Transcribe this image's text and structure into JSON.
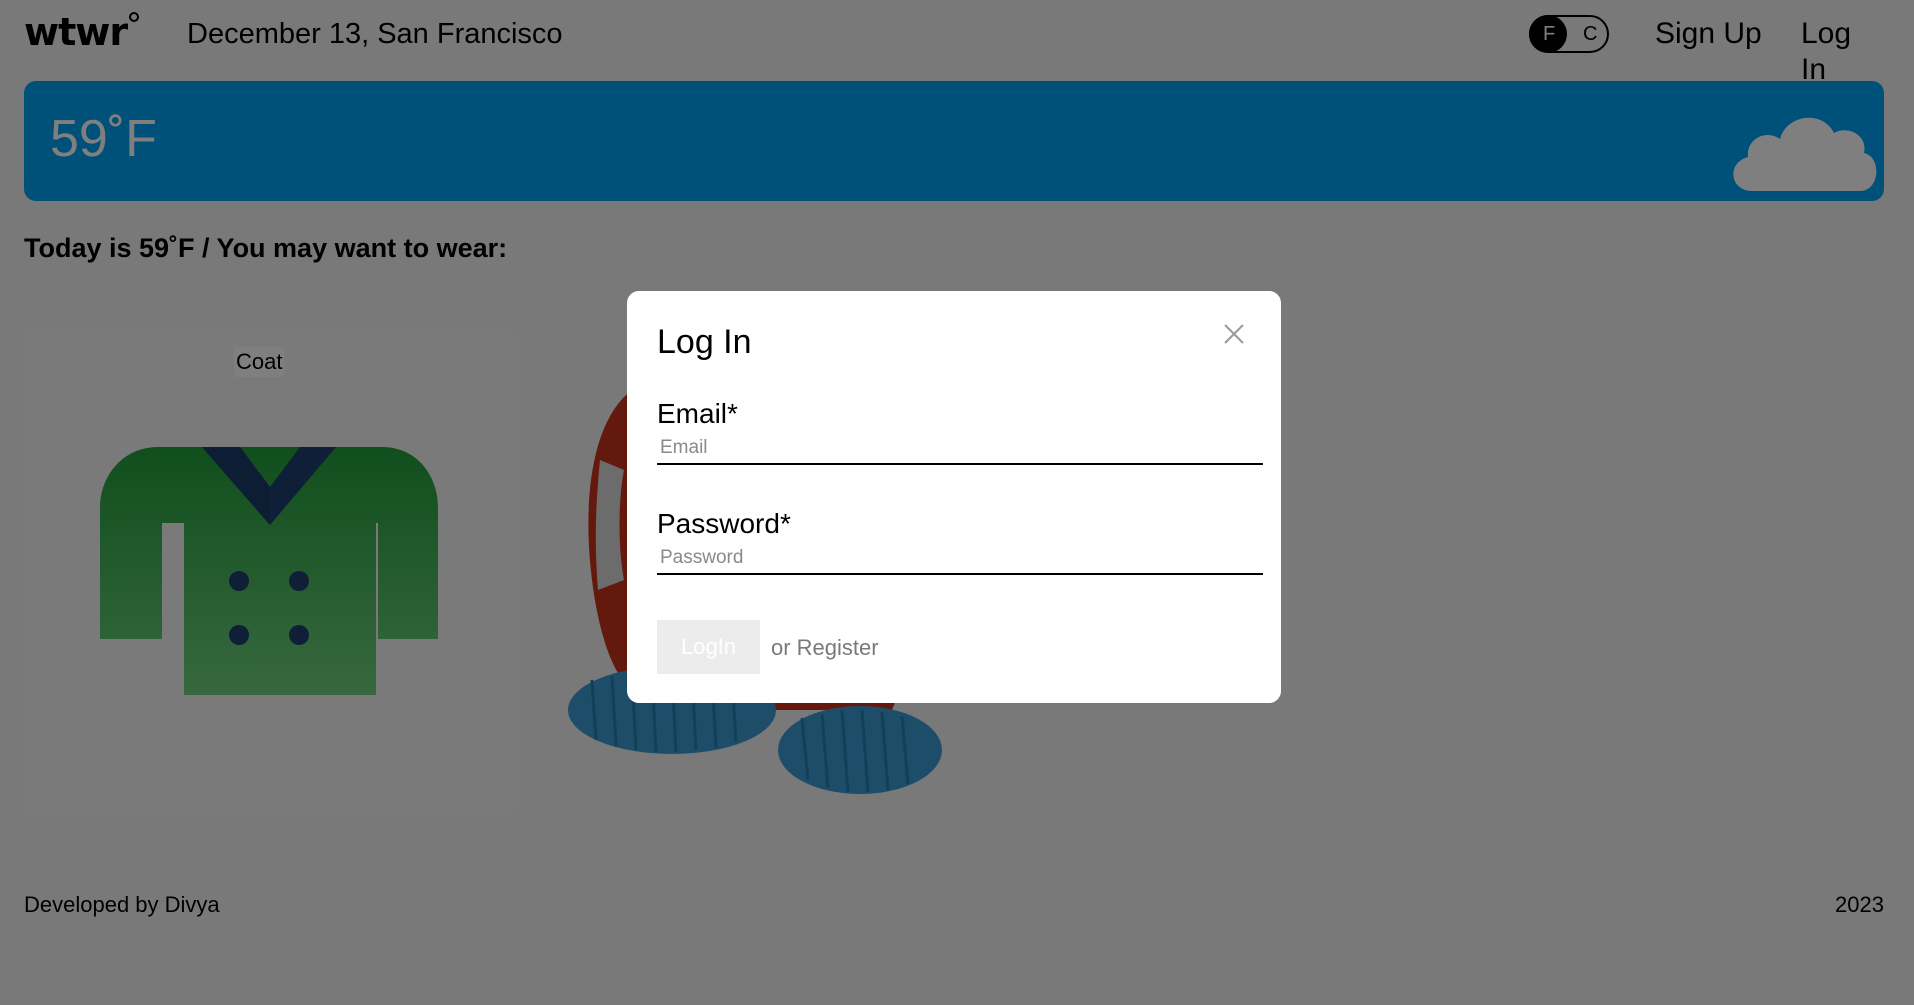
{
  "header": {
    "logo": "wtwr",
    "date_location": "December 13, San Francisco",
    "unit_toggle": {
      "left": "F",
      "right": "C",
      "selected": "F"
    },
    "nav": {
      "sign_up": "Sign Up",
      "log_in": "Log In"
    }
  },
  "weather": {
    "temperature": "59˚F",
    "condition_icon": "cloud-icon",
    "color": "#00a3f5"
  },
  "main": {
    "today_text": "Today is 59˚F / You may want to wear:",
    "items": [
      {
        "label": "Coat",
        "icon": "coat-icon"
      }
    ]
  },
  "footer": {
    "credit": "Developed by Divya",
    "year": "2023"
  },
  "modal": {
    "title": "Log In",
    "email": {
      "label": "Email*",
      "placeholder": "Email",
      "value": ""
    },
    "password": {
      "label": "Password*",
      "placeholder": "Password",
      "value": ""
    },
    "submit_label": "LogIn",
    "alt_link": "or Register",
    "close_icon": "close-icon"
  }
}
